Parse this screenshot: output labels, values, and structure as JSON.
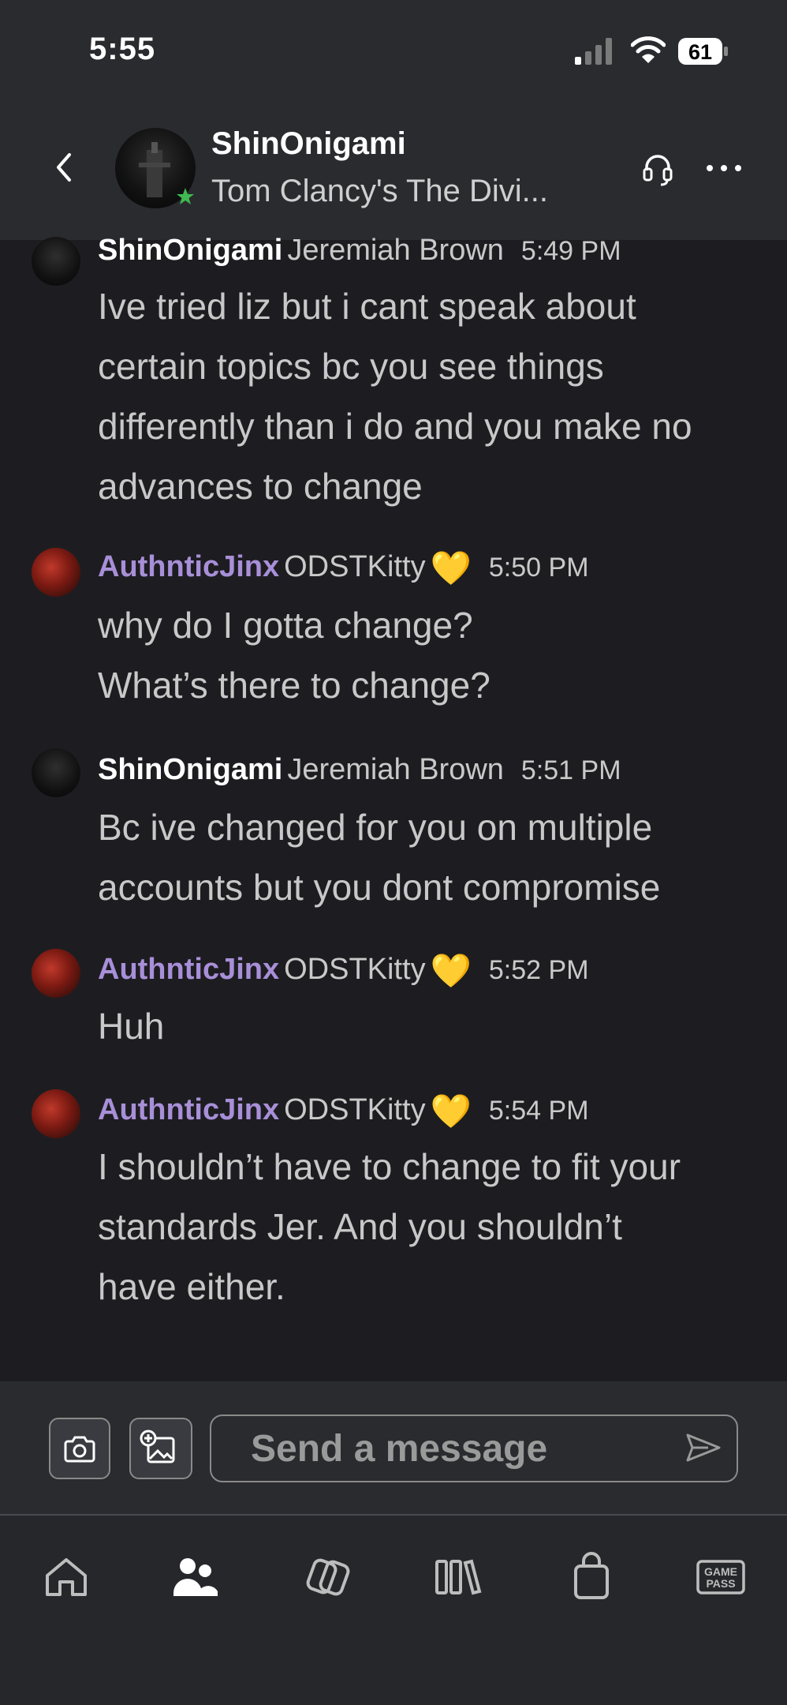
{
  "status_bar": {
    "time": "5:55",
    "battery": "61"
  },
  "header": {
    "name": "ShinOnigami",
    "subtitle": "Tom Clancy's The Divi...",
    "presence_color": "#3fb950"
  },
  "messages": [
    {
      "gamertag": "ShinOnigami",
      "real_name": "Jeremiah Brown",
      "emoji": "",
      "time": "5:49 PM",
      "lines": [
        "Ive tried liz but i cant speak about",
        "certain topics bc you see things",
        "differently than i do and you make no",
        "advances to change"
      ]
    },
    {
      "gamertag": "AuthnticJinx",
      "real_name": "ODSTKitty",
      "emoji": "💛",
      "time": "5:50 PM",
      "lines": [
        "why do I gotta change?",
        "What’s there to change?"
      ]
    },
    {
      "gamertag": "ShinOnigami",
      "real_name": "Jeremiah Brown",
      "emoji": "",
      "time": "5:51 PM",
      "lines": [
        "Bc ive changed for you on multiple",
        "accounts but you dont compromise"
      ]
    },
    {
      "gamertag": "AuthnticJinx",
      "real_name": "ODSTKitty",
      "emoji": "💛",
      "time": "5:52 PM",
      "lines": [
        "Huh"
      ]
    },
    {
      "gamertag": "AuthnticJinx",
      "real_name": "ODSTKitty",
      "emoji": "💛",
      "time": "5:54 PM",
      "lines": [
        "I shouldn’t have to change to fit your",
        "standards Jer. And you shouldn’t",
        "have either."
      ]
    }
  ],
  "composer": {
    "placeholder": "Send a message"
  },
  "nav": {
    "game_pass_line1": "GAME",
    "game_pass_line2": "PASS"
  },
  "colors": {
    "accent_purple": "#a88fd8",
    "heart": "#f3c531",
    "background": "#1d1d21"
  }
}
